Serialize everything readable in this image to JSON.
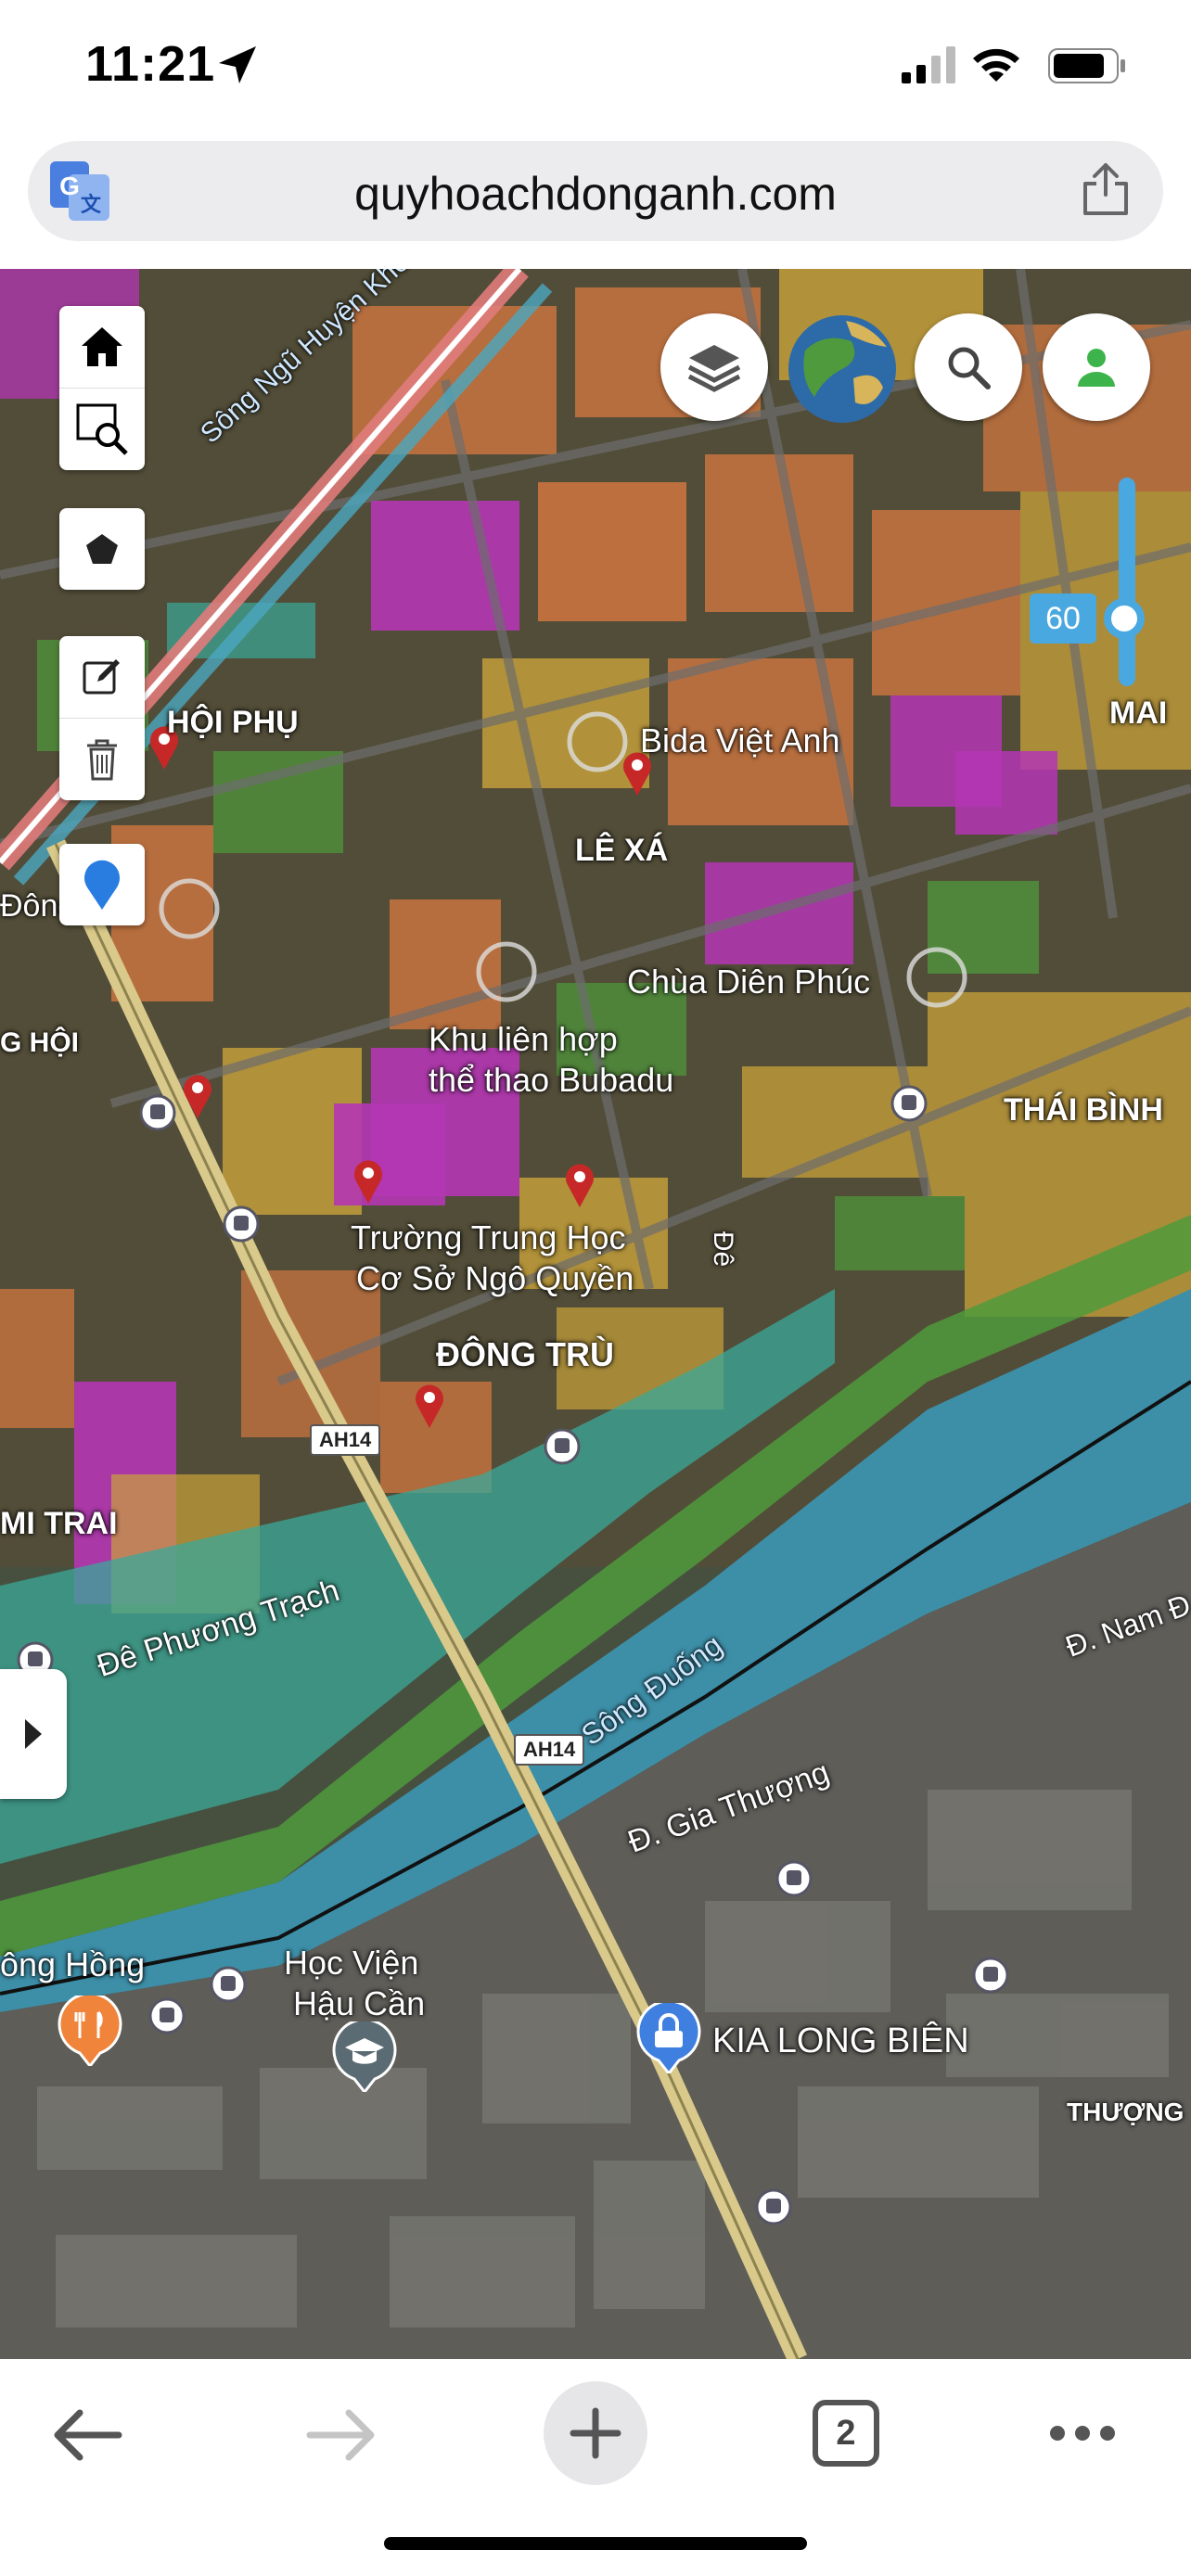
{
  "status_bar": {
    "time": "11:21"
  },
  "browser": {
    "url": "quyhoachdonganh.com",
    "tab_count": "2"
  },
  "map": {
    "slider_value": "60",
    "labels": {
      "song_ngu_huyen_khe": "Sông Ngũ Huyện Khê",
      "hoi_phu": "HỘI PHỤ",
      "bida_viet_anh": "Bida Việt Anh",
      "le_xa": "LÊ XÁ",
      "mai": "MAI",
      "dong": "Đông",
      "chua_dien_phuc": "Chùa Diên Phúc",
      "g_hoi": "G HỘI",
      "khu_lien_hop_1": "Khu liên hợp",
      "khu_lien_hop_2": "thể thao Bubadu",
      "thai_binh": "THÁI BÌNH",
      "truong_1": "Trường Trung Học",
      "truong_2": "Cơ Sở Ngô Quyền",
      "de": "Đê",
      "dong_tru": "ĐÔNG TRÙ",
      "ah14_a": "AH14",
      "ah14_b": "AH14",
      "mi_trai": "MI TRAI",
      "de_phuong_trach": "Đê Phương Trạch",
      "song_duong": "Sông Đuống",
      "d_nam": "Đ. Nam Đ",
      "d_gia_thuong": "Đ. Gia Thượng",
      "song_hong": "ông Hồng",
      "hoc_vien_1": "Học Viện",
      "hoc_vien_2": "Hậu Cần",
      "kia_long_bien": "KIA LONG BIÊN",
      "thuong": "THƯỢNG"
    }
  },
  "colors": {
    "accent": "#4aa8e0",
    "plan_orange": "#c9743f",
    "plan_magenta": "#b436b4",
    "plan_yellow": "#c9a23a",
    "plan_green": "#4f9a3c",
    "plan_teal": "#3aa89a",
    "river": "#3d8fa8",
    "pin_red": "#c62828",
    "user_green": "#3cb44b"
  },
  "icons": {
    "home": "home-icon",
    "zoom_select": "zoom-select-icon",
    "polygon": "polygon-icon",
    "edit": "edit-icon",
    "trash": "trash-icon",
    "location": "location-pin-icon",
    "layers": "layers-icon",
    "globe": "globe-icon",
    "search": "search-icon",
    "user": "user-icon"
  }
}
